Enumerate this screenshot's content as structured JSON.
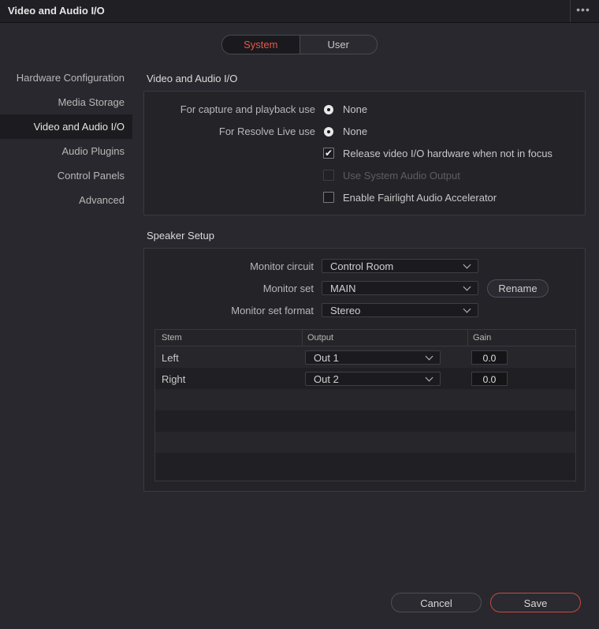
{
  "window": {
    "title": "Video and Audio I/O",
    "more_label": "•••"
  },
  "scope_tabs": [
    {
      "label": "System",
      "active": true
    },
    {
      "label": "User",
      "active": false
    }
  ],
  "sidebar": {
    "items": [
      {
        "label": "Hardware Configuration",
        "active": false
      },
      {
        "label": "Media Storage",
        "active": false
      },
      {
        "label": "Video and Audio I/O",
        "active": true
      },
      {
        "label": "Audio Plugins",
        "active": false
      },
      {
        "label": "Control Panels",
        "active": false
      },
      {
        "label": "Advanced",
        "active": false
      }
    ]
  },
  "io_section": {
    "title": "Video and Audio I/O",
    "capture_label": "For capture and playback use",
    "capture_value": "None",
    "live_label": "For Resolve Live use",
    "live_value": "None",
    "release_label": "Release video I/O hardware when not in focus",
    "release_checked": true,
    "system_audio_label": "Use System Audio Output",
    "system_audio_checked": false,
    "system_audio_disabled": true,
    "fairlight_label": "Enable Fairlight Audio Accelerator",
    "fairlight_checked": false
  },
  "speaker_section": {
    "title": "Speaker Setup",
    "monitor_circuit_label": "Monitor circuit",
    "monitor_circuit_value": "Control Room",
    "monitor_set_label": "Monitor set",
    "monitor_set_value": "MAIN",
    "rename_label": "Rename",
    "monitor_set_format_label": "Monitor set format",
    "monitor_set_format_value": "Stereo",
    "table": {
      "headers": [
        "Stem",
        "Output",
        "Gain"
      ],
      "rows": [
        {
          "stem": "Left",
          "output": "Out 1",
          "gain": "0.0"
        },
        {
          "stem": "Right",
          "output": "Out 2",
          "gain": "0.0"
        }
      ]
    }
  },
  "footer": {
    "cancel_label": "Cancel",
    "save_label": "Save"
  },
  "colors": {
    "accent": "#e8574a",
    "background": "#28282e",
    "panel": "#232328"
  }
}
